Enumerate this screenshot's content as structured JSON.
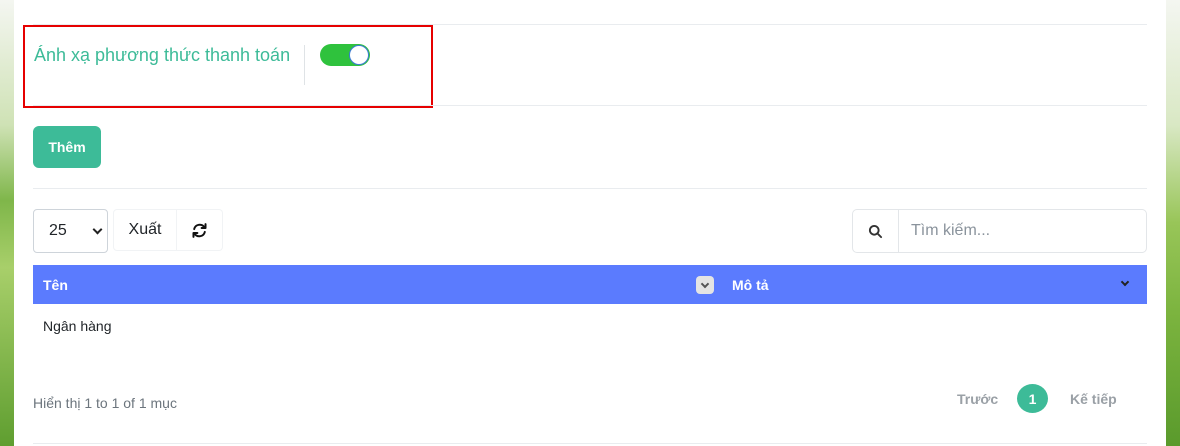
{
  "settings": {
    "payment_mapping_label": "Ánh xạ phương thức thanh toán",
    "payment_mapping_enabled": true
  },
  "toolbar": {
    "add_label": "Thêm",
    "export_label": "Xuất",
    "page_length": "25",
    "search_placeholder": "Tìm kiếm..."
  },
  "table": {
    "headers": [
      "Tên",
      "Mô tả"
    ],
    "rows": [
      {
        "name": "Ngân hàng",
        "description": ""
      }
    ]
  },
  "footer": {
    "info": "Hiển thị 1 to 1 of 1 mục",
    "prev_label": "Trước",
    "current_page": "1",
    "next_label": "Kế tiếp"
  },
  "colors": {
    "accent": "#3dbb98",
    "header_bg": "#5b7bfe",
    "toggle_on": "#2fc23d",
    "highlight_border": "#e60000"
  }
}
